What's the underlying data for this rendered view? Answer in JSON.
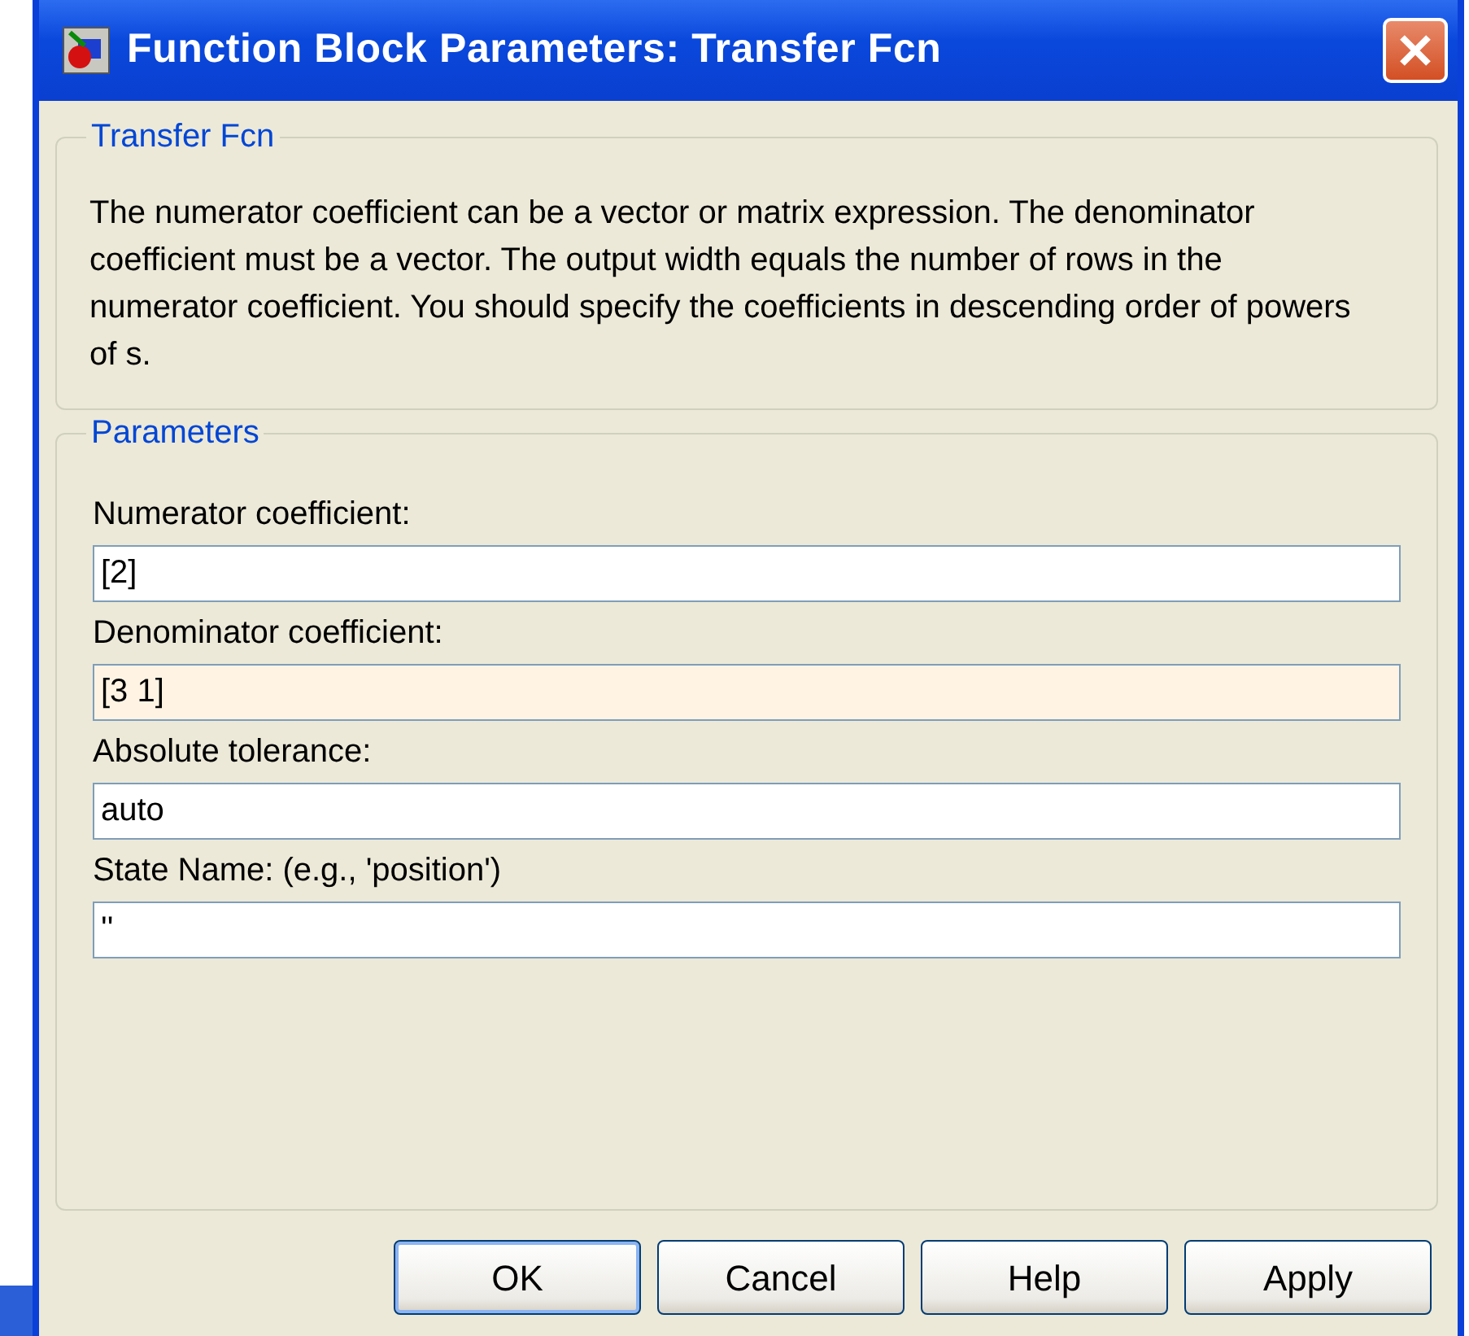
{
  "window": {
    "title": "Function Block Parameters: Transfer Fcn"
  },
  "description_group": {
    "title": "Transfer Fcn",
    "text": "The numerator coefficient can be a vector or matrix expression. The denominator coefficient must be a vector. The output width equals the number of rows in the numerator coefficient. You should specify the coefficients in descending order of powers of s."
  },
  "parameters_group": {
    "title": "Parameters",
    "fields": [
      {
        "label": "Numerator coefficient:",
        "value": "[2]",
        "focused": false
      },
      {
        "label": "Denominator coefficient:",
        "value": "[3 1]",
        "focused": true
      },
      {
        "label": "Absolute tolerance:",
        "value": "auto",
        "focused": false
      },
      {
        "label": "State Name: (e.g., 'position')",
        "value": "''",
        "focused": false
      }
    ]
  },
  "buttons": [
    {
      "label": "OK",
      "default": true
    },
    {
      "label": "Cancel",
      "default": false
    },
    {
      "label": "Help",
      "default": false
    },
    {
      "label": "Apply",
      "default": false
    }
  ]
}
